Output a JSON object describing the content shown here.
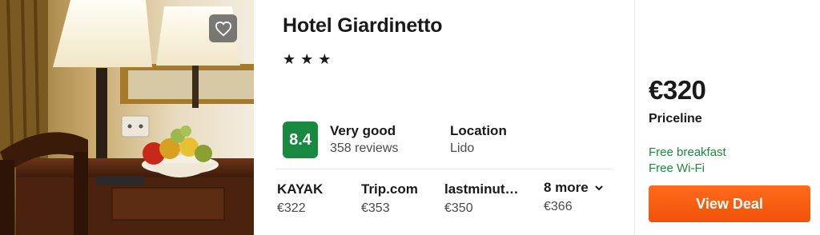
{
  "hotel": {
    "name": "Hotel Giardinetto",
    "star_rating": 3,
    "stars": [
      "★",
      "★",
      "★"
    ]
  },
  "rating": {
    "score": "8.4",
    "label": "Very good",
    "reviews": "358 reviews",
    "badge_color": "#188a3f"
  },
  "location": {
    "label": "Location",
    "value": "Lido"
  },
  "providers": [
    {
      "name": "KAYAK",
      "price": "€322"
    },
    {
      "name": "Trip.com",
      "price": "€353"
    },
    {
      "name": "lastminut…",
      "price": "€350"
    }
  ],
  "more": {
    "label": "8 more",
    "price": "€366"
  },
  "deal": {
    "price": "€320",
    "provider": "Priceline",
    "perks": [
      "Free breakfast",
      "Free Wi-Fi"
    ],
    "button_label": "View Deal",
    "perk_color": "#1e8a3c",
    "button_color": "#f5590d"
  },
  "icons": {
    "favorite": "heart-icon",
    "more_chevron": "chevron-down-icon"
  }
}
